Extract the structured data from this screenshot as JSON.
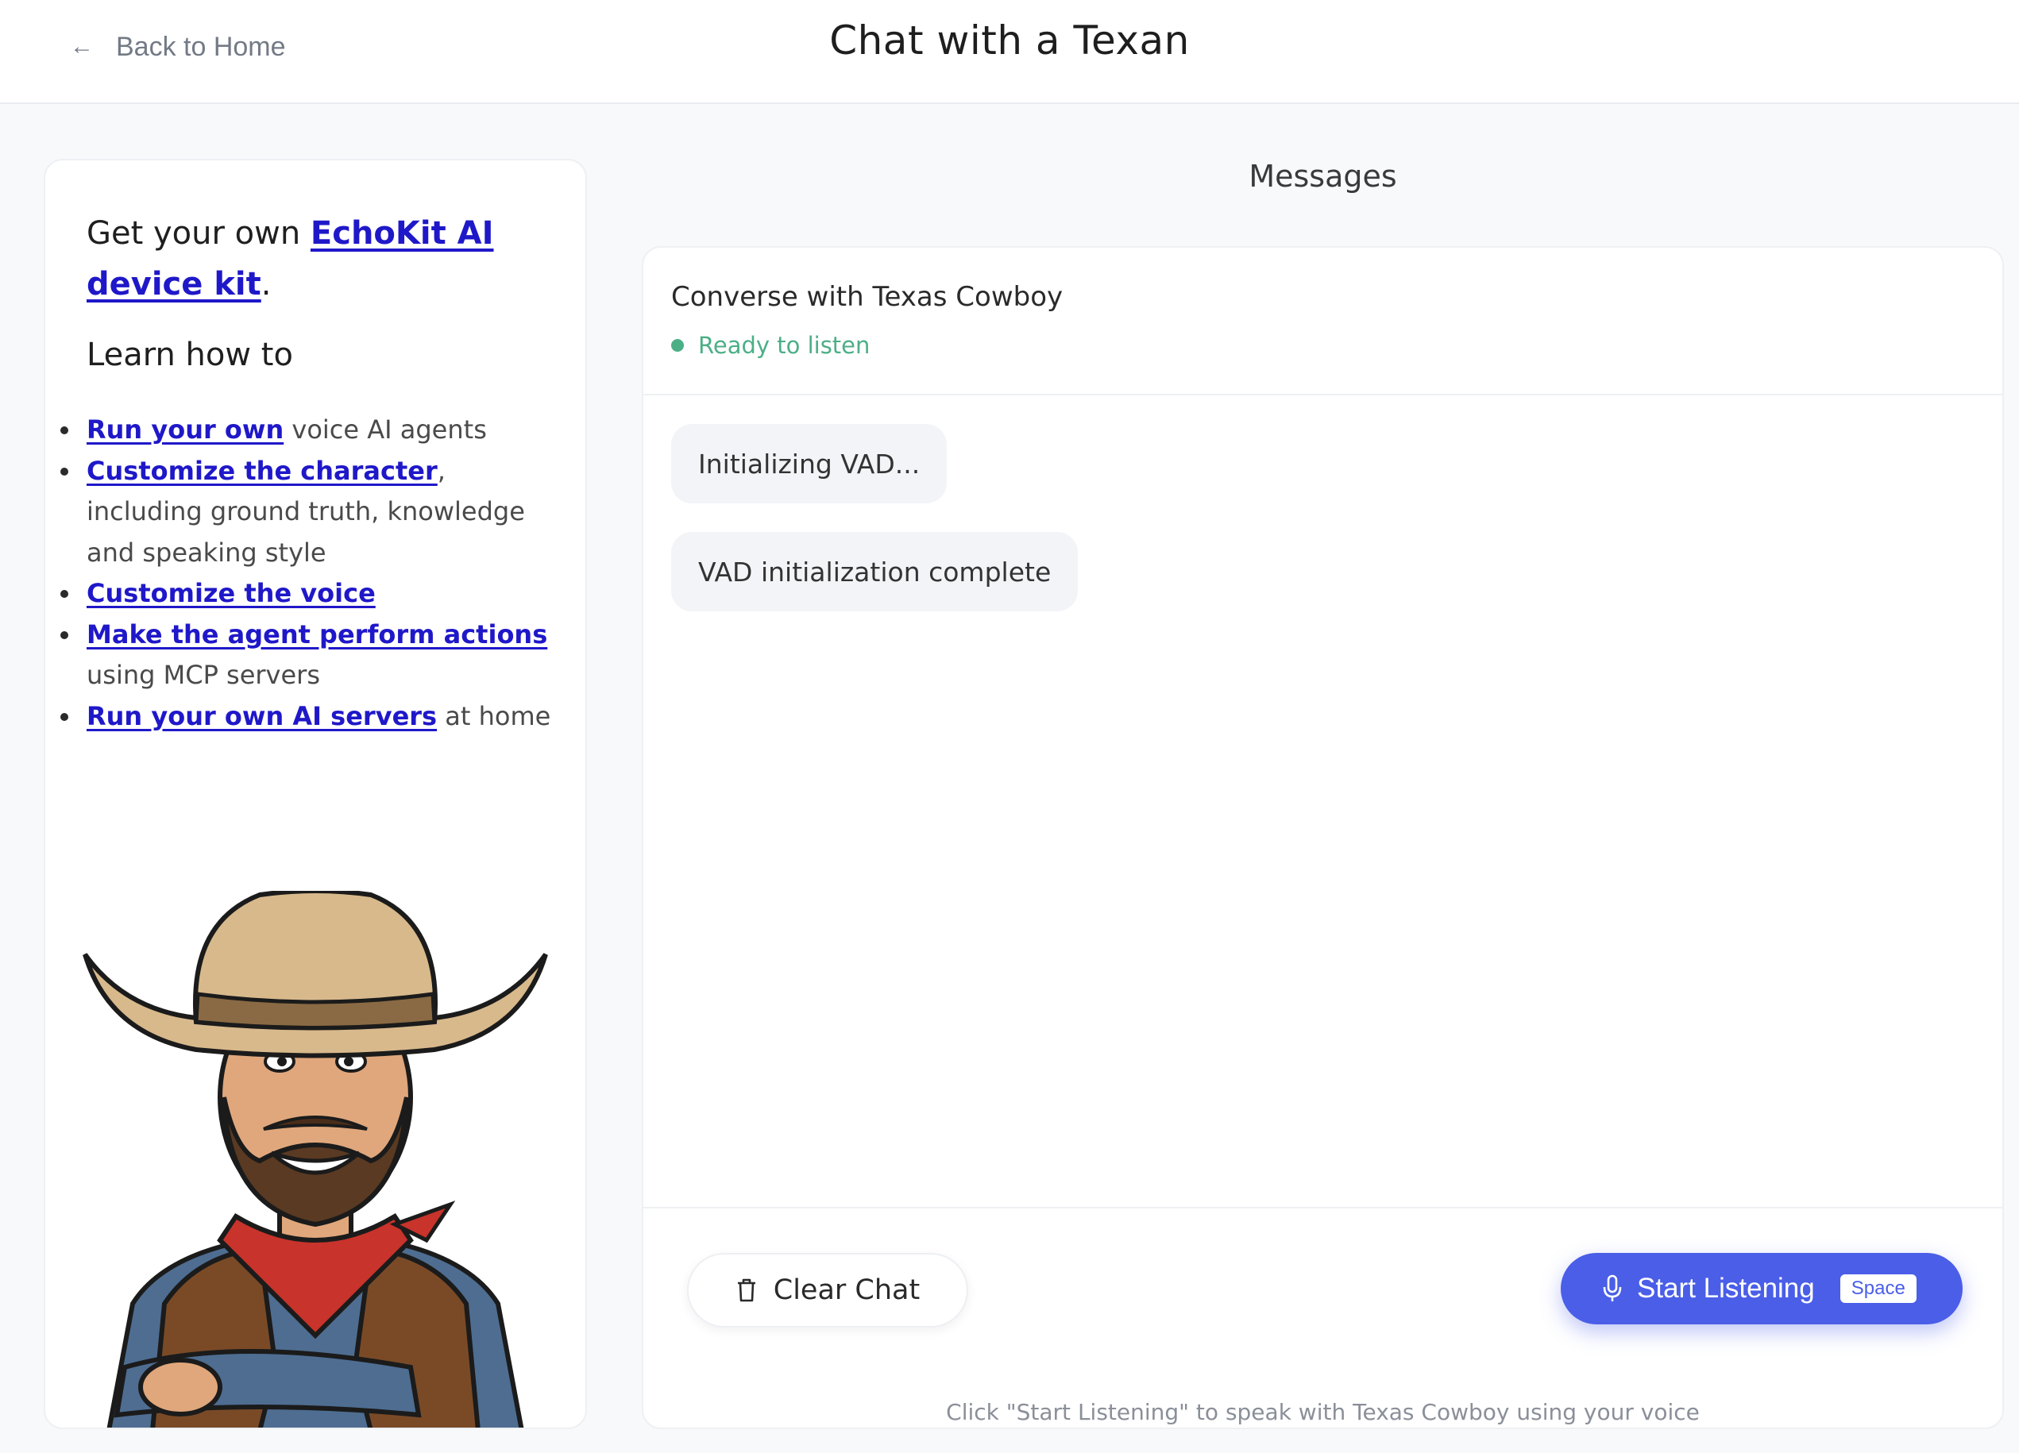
{
  "header": {
    "back_label": "Back to Home",
    "title": "Chat with a Texan"
  },
  "left_panel": {
    "promo_prefix": "Get your own ",
    "promo_link": "EchoKit AI device kit",
    "promo_suffix": ".",
    "learn_heading": "Learn how to",
    "items": [
      {
        "link": "Run your own",
        "rest": " voice AI agents"
      },
      {
        "link": "Customize the character",
        "rest": ", including ground truth, knowledge and speaking style"
      },
      {
        "link": "Customize the voice",
        "rest": ""
      },
      {
        "link": "Make the agent perform actions",
        "rest": " using MCP servers"
      },
      {
        "link": "Run your own AI servers",
        "rest": " at home"
      }
    ]
  },
  "chat": {
    "section_heading": "Messages",
    "title": "Converse with Texas Cowboy",
    "status": "Ready to listen",
    "messages": [
      "Initializing VAD...",
      "VAD initialization complete"
    ],
    "clear_label": "Clear Chat",
    "start_label": "Start Listening",
    "shortcut": "Space",
    "hint": "Click \"Start Listening\" to speak with Texas Cowboy using your voice"
  },
  "colors": {
    "accent": "#4a5ee8",
    "link": "#1f18c9",
    "status_green": "#4caf86"
  },
  "icons": [
    "arrow-left-icon",
    "trash-icon",
    "microphone-icon"
  ]
}
